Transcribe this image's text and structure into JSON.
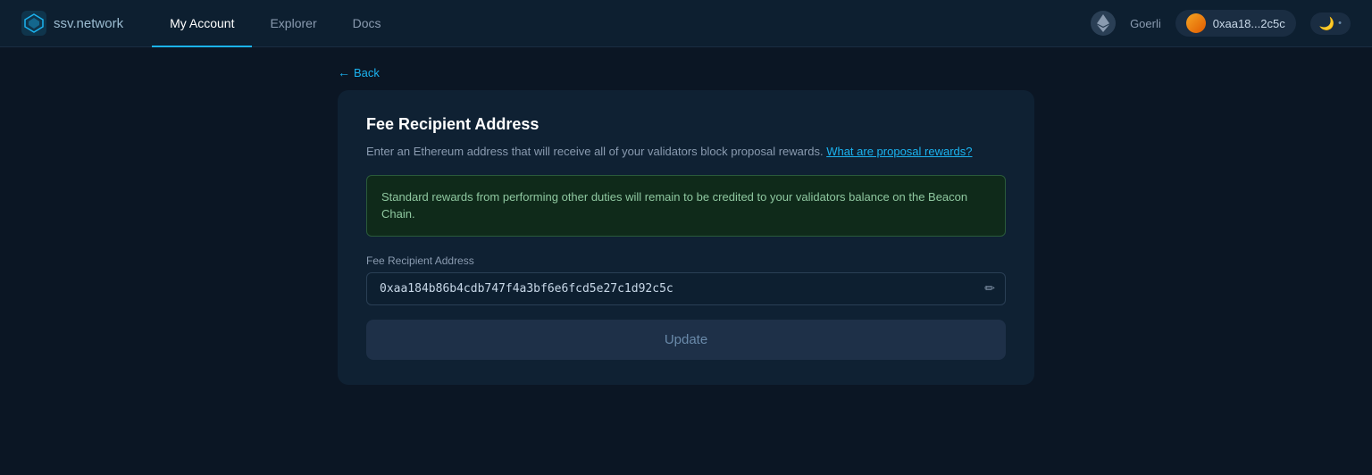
{
  "navbar": {
    "logo_text_bold": "ssv",
    "logo_text_light": ".network",
    "nav_links": [
      {
        "label": "My Account",
        "active": true
      },
      {
        "label": "Explorer",
        "active": false
      },
      {
        "label": "Docs",
        "active": false
      }
    ],
    "network": "Goerli",
    "wallet_address": "0xaa18...2c5c",
    "theme_icon": "🌙"
  },
  "back_link": {
    "label": "Back",
    "arrow": "←"
  },
  "card": {
    "title": "Fee Recipient Address",
    "description_text": "Enter an Ethereum address that will receive all of your validators block proposal rewards.",
    "description_link_text": "What are proposal rewards?",
    "info_box_text": "Standard rewards from performing other duties will remain to be credited to your validators balance on the Beacon Chain.",
    "form_label": "Fee Recipient Address",
    "address_value": "0xaa184b86b4cdb747f4a3bf6e6fcd5e27c1d92c5c",
    "edit_icon": "✏",
    "update_button_label": "Update"
  }
}
